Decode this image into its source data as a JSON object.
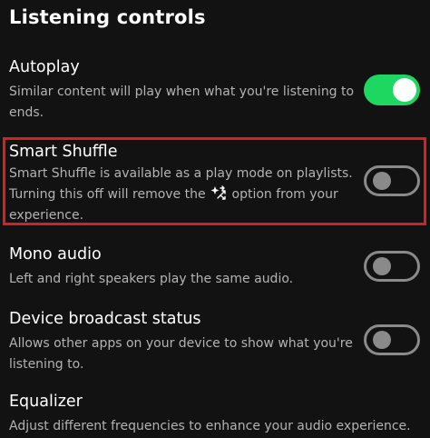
{
  "section": {
    "title": "Listening controls"
  },
  "settings": {
    "autoplay": {
      "title": "Autoplay",
      "desc_lines": [
        "Similar content will play when what you're listening to",
        "ends."
      ],
      "enabled": true
    },
    "smart_shuffle": {
      "title": "Smart Shuffle",
      "desc_line1": "Smart Shuffle is available as a play mode on playlists.",
      "desc_line2_before": "Turning this off will remove the",
      "desc_line2_after": "option from your",
      "desc_line3": "experience.",
      "inline_icon": "smart-shuffle-icon",
      "enabled": false,
      "highlighted": true
    },
    "mono_audio": {
      "title": "Mono audio",
      "desc": "Left and right speakers play the same audio.",
      "enabled": false
    },
    "device_broadcast": {
      "title": "Device broadcast status",
      "desc_lines": [
        "Allows other apps on your device to show what you're",
        "listening to."
      ],
      "enabled": false
    },
    "equalizer": {
      "title": "Equalizer",
      "desc": "Adjust different frequencies to enhance your audio experience."
    }
  },
  "colors": {
    "background": "#121212",
    "accent_green": "#1ed760",
    "highlight_red": "#d91f26",
    "secondary_text": "#b3b3b3",
    "toggle_off": "#8a8a8a"
  }
}
